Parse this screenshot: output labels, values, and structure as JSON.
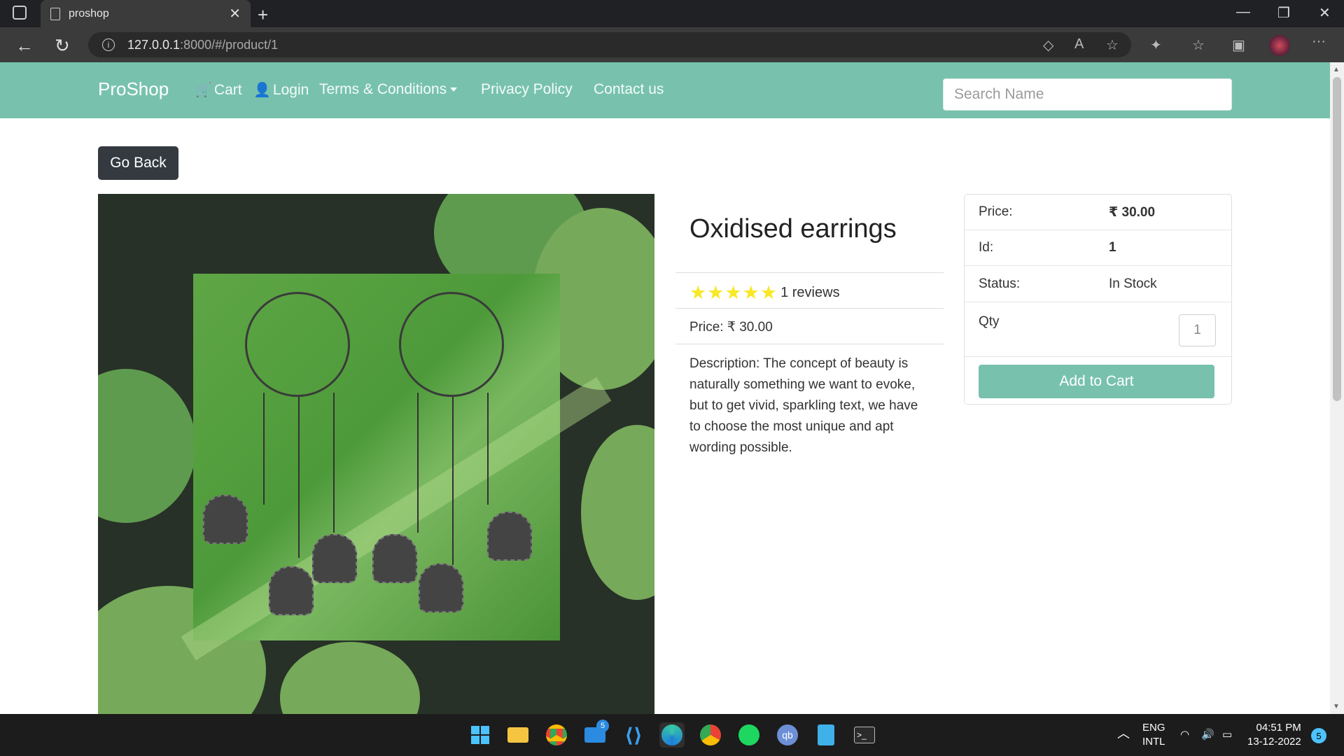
{
  "browser": {
    "tab_title": "proshop",
    "url_host": "127.0.0.1",
    "url_rest": ":8000/#/product/1"
  },
  "navbar": {
    "brand": "ProShop",
    "cart": "Cart",
    "login": "Login",
    "terms": "Terms & Conditions",
    "privacy": "Privacy Policy",
    "contact": "Contact us",
    "search_placeholder": "Search Name"
  },
  "page": {
    "go_back": "Go Back"
  },
  "product": {
    "name": "Oxidised earrings",
    "rating": 5,
    "reviews_text": "1 reviews",
    "price_line": "Price: ₹ 30.00",
    "description": "Description: The concept of beauty is naturally something we want to evoke, but to get vivid, sparkling text, we have to choose the most unique and apt wording possible."
  },
  "card": {
    "price_label": "Price:",
    "price_value": "₹ 30.00",
    "id_label": "Id:",
    "id_value": "1",
    "status_label": "Status:",
    "status_value": "In Stock",
    "qty_label": "Qty",
    "qty_value": "1",
    "add_to_cart": "Add to Cart"
  },
  "taskbar": {
    "mail_badge": "5",
    "lang": "ENG",
    "layout": "INTL",
    "time": "04:51 PM",
    "date": "13-12-2022",
    "notifications": "5"
  },
  "colors": {
    "navbar": "#78c2ad",
    "go_back_bg": "#343a40",
    "star": "#f8e825"
  }
}
